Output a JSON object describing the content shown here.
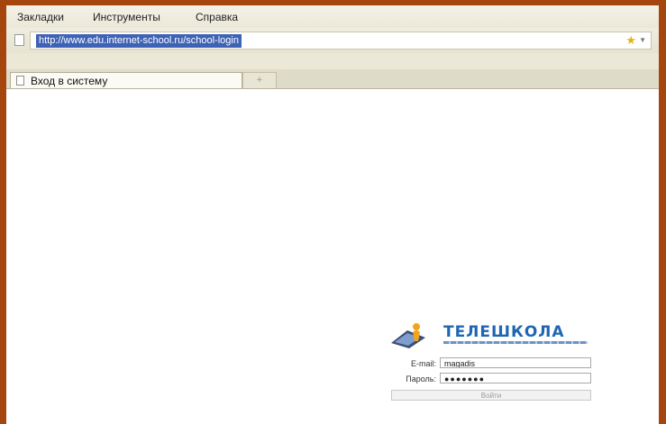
{
  "menu": {
    "bookmarks": "Закладки",
    "tools": "Инструменты",
    "help": "Справка"
  },
  "address": {
    "url": "http://www.edu.internet-school.ru/school-login"
  },
  "tab": {
    "title": "Вход в систему",
    "new_tab": "+"
  },
  "login": {
    "logo_text": "ТЕЛЕШКОЛА",
    "email_label": "E-mail:",
    "email_value": "magadis",
    "password_label": "Пароль:",
    "password_value": "●●●●●●●",
    "submit_label": "Войти"
  },
  "colors": {
    "frame": "#a5460f",
    "url_highlight": "#3e62b6",
    "logo": "#1e66b4"
  }
}
